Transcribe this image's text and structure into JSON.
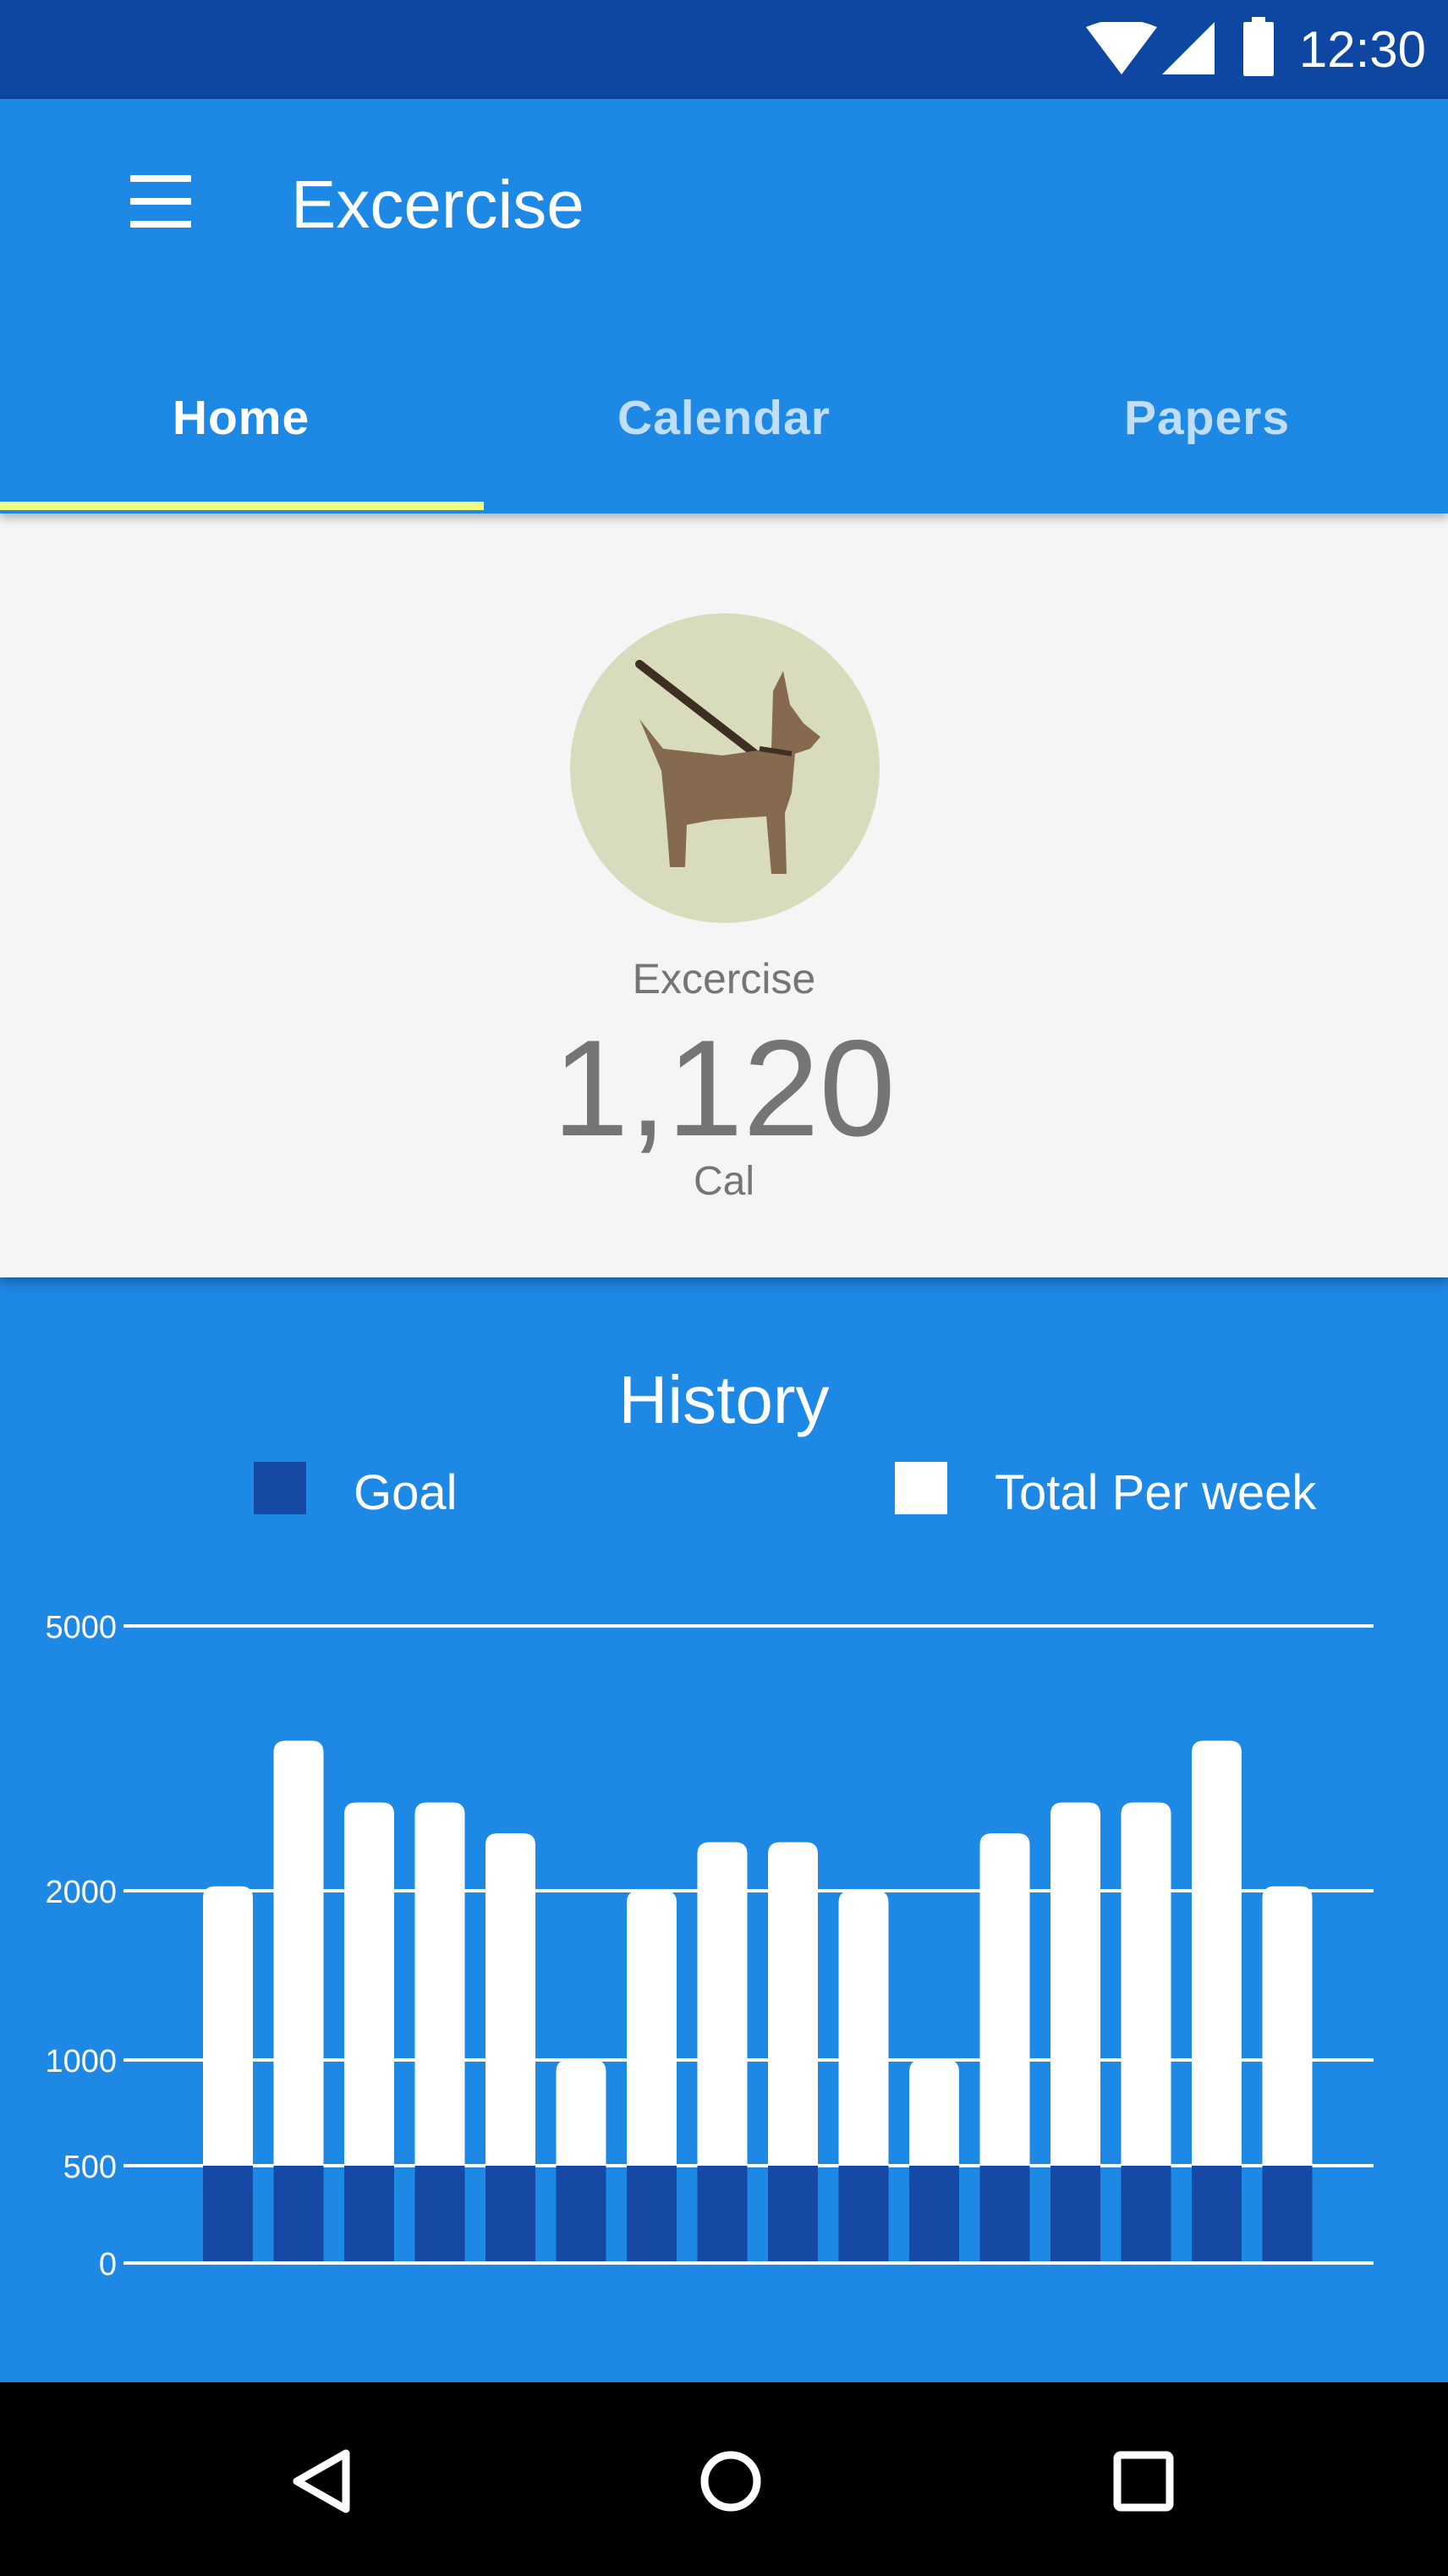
{
  "status_bar": {
    "time": "12:30",
    "icons": [
      "wifi-icon",
      "signal-icon",
      "battery-icon"
    ]
  },
  "app_bar": {
    "title": "Excercise",
    "menu_icon": "hamburger-menu-icon",
    "tabs": [
      {
        "label": "Home",
        "active": true
      },
      {
        "label": "Calendar",
        "active": false
      },
      {
        "label": "Papers",
        "active": false
      }
    ]
  },
  "summary": {
    "avatar_icon": "dog-walking-icon",
    "label": "Excercise",
    "value": "1,120",
    "unit": "Cal"
  },
  "history": {
    "title": "History",
    "legend": [
      {
        "label": "Goal",
        "color": "#1649A3"
      },
      {
        "label": "Total Per week",
        "color": "#FFFFFF"
      }
    ]
  },
  "chart_data": {
    "type": "bar",
    "title": "History",
    "series": [
      {
        "name": "Goal",
        "values": [
          500,
          500,
          500,
          500,
          500,
          500,
          500,
          500,
          500,
          500,
          500,
          500,
          500,
          500,
          500,
          500
        ]
      },
      {
        "name": "Total Per week",
        "values": [
          2050,
          3700,
          3000,
          3000,
          2650,
          1000,
          2000,
          2550,
          2550,
          2000,
          1000,
          2650,
          3000,
          3000,
          3700,
          2050
        ]
      }
    ],
    "y_ticks": [
      0,
      500,
      1000,
      2000,
      5000
    ],
    "y_tick_labels": [
      "0",
      "500",
      "1000",
      "2000",
      "5000"
    ],
    "ylim": [
      0,
      5000
    ],
    "y_scale": "nonlinear (ticks unevenly spaced)",
    "legend_position": "top",
    "grid": true
  },
  "nav_bar": {
    "buttons": [
      "back-icon",
      "home-icon",
      "recents-icon"
    ]
  },
  "colors": {
    "status_bar": "#0D47A1",
    "primary": "#1E88E5",
    "tab_indicator": "#EEFF81",
    "card_background": "#F5F5F5",
    "avatar_background": "#D9DCBC",
    "dog": "#856A4F",
    "goal_bar": "#1649A3",
    "total_bar": "#FFFFFF",
    "nav_bar": "#000000"
  }
}
